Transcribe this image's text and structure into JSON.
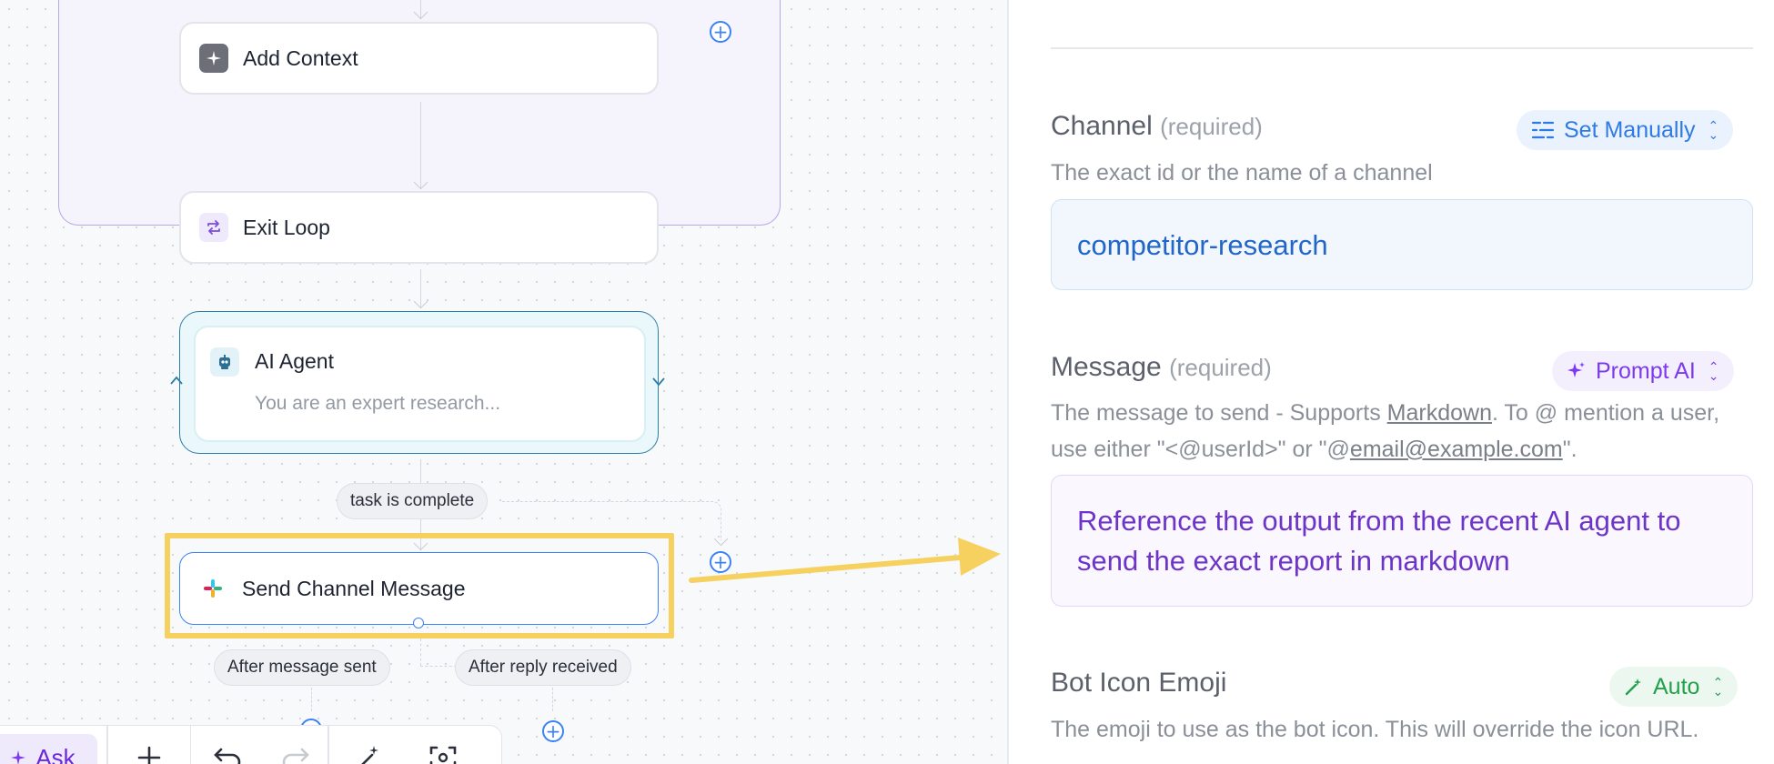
{
  "canvas": {
    "nodes": {
      "add_context": "Add Context",
      "exit_loop": "Exit Loop",
      "ai_agent_title": "AI Agent",
      "ai_agent_subtitle": "You are an expert research...",
      "send_channel_message": "Send Channel Message"
    },
    "branches": {
      "task_complete": "task is complete",
      "after_message_sent": "After message sent",
      "after_reply_received": "After reply received"
    },
    "toolbar": {
      "ask": "Ask"
    }
  },
  "panel": {
    "channel": {
      "label": "Channel",
      "required": "(required)",
      "mode": "Set Manually",
      "description": "The exact id or the name of a channel",
      "value": "competitor-research"
    },
    "message": {
      "label": "Message",
      "required": "(required)",
      "mode": "Prompt AI",
      "desc_part1": "The message to send - Supports ",
      "desc_link1": "Markdown",
      "desc_part2": ". To @ mention a user, use either \"<@userId>\" or \"@",
      "desc_link2": "email@example.com",
      "desc_part3": "\".",
      "value": "Reference the output from the recent AI agent to send the exact report in markdown"
    },
    "bot_icon": {
      "label": "Bot Icon Emoji",
      "mode": "Auto",
      "description": "The emoji to use as the bot icon. This will override the icon URL."
    }
  },
  "colors": {
    "highlight": "#f7d160",
    "accent_blue": "#3b82f6",
    "prompt_purple": "#7c3aed",
    "auto_green": "#16a34a",
    "loop_border": "#b8a8e6",
    "agent_border": "#2a7da6"
  },
  "icons": [
    "sparkle-icon",
    "loop-icon",
    "robot-icon",
    "slack-icon",
    "plus-circle-icon",
    "undo-icon",
    "redo-icon",
    "magic-wand-icon",
    "focus-icon",
    "list-icon",
    "chevron-updown-icon"
  ]
}
